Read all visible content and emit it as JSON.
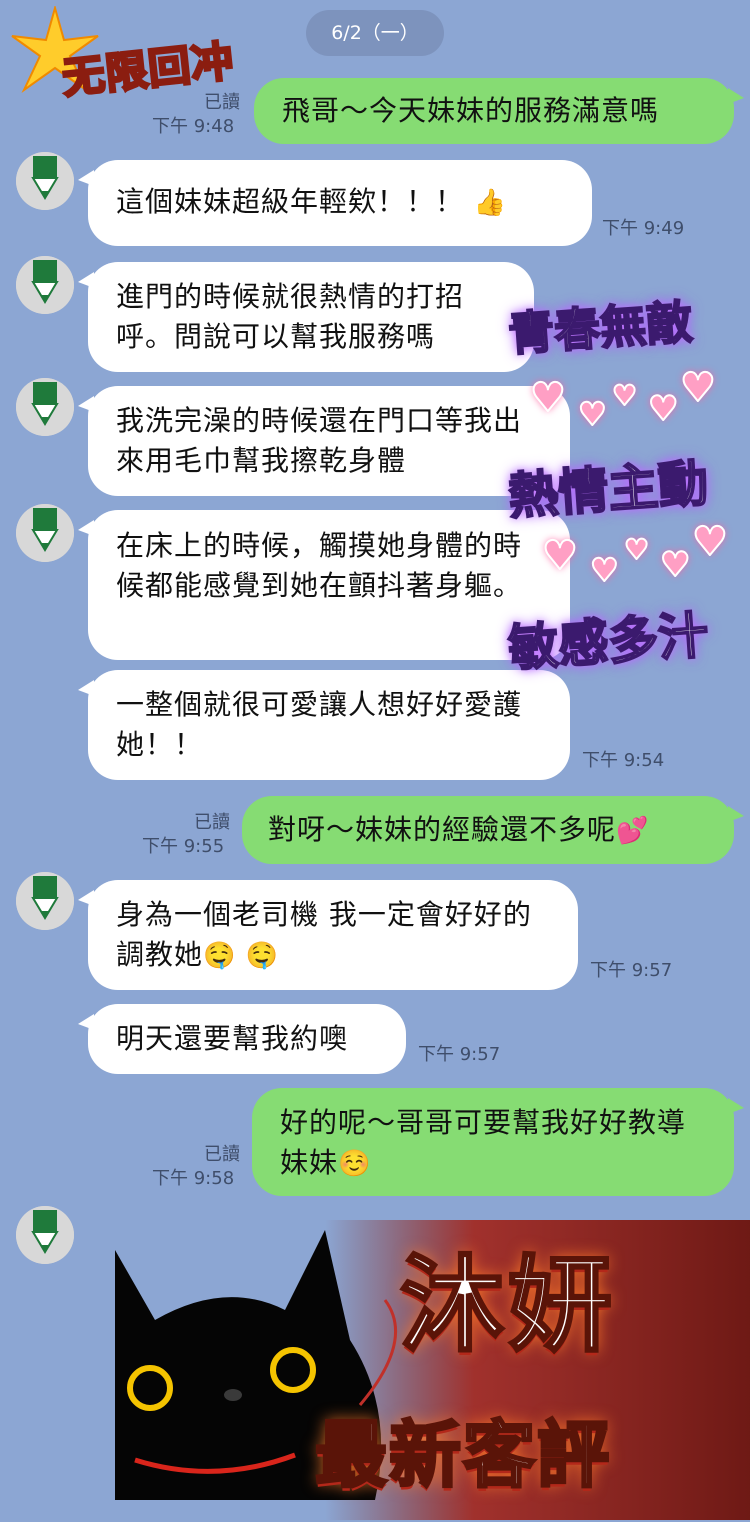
{
  "date_label": "6/2（一）",
  "promo": {
    "top_badge": "无限回冲",
    "side_badges": [
      "青春無敵",
      "熱情主動",
      "敏感多汁"
    ],
    "banner_line1": "沐妍",
    "banner_line2": "最新客評"
  },
  "messages": [
    {
      "side": "out",
      "text": "飛哥～今天妹妹的服務滿意嗎",
      "read": "已讀",
      "time": "下午 9:48"
    },
    {
      "side": "in",
      "text": "這個妹妹超級年輕欸！！！",
      "emoji": "👍",
      "time": "下午 9:49"
    },
    {
      "side": "in",
      "text": "進門的時候就很熱情的打招呼。問說可以幫我服務嗎",
      "time": ""
    },
    {
      "side": "in",
      "text": "我洗完澡的時候還在門口等我出來用毛巾幫我擦乾身體",
      "time": ""
    },
    {
      "side": "in",
      "text": "在床上的時候，觸摸她身體的時候都能感覺到她在顫抖著身軀。",
      "time": ""
    },
    {
      "side": "in",
      "text": "一整個就很可愛讓人想好好愛護她！！",
      "time": "下午 9:54"
    },
    {
      "side": "out",
      "text": "對呀～妹妹的經驗還不多呢",
      "emoji": "💕",
      "read": "已讀",
      "time": "下午 9:55"
    },
    {
      "side": "in",
      "text": "身為一個老司機 我一定會好好的調教她",
      "emoji": "🤤 🤤",
      "time": "下午 9:57"
    },
    {
      "side": "in",
      "text": "明天還要幫我約噢",
      "time": "下午 9:57"
    },
    {
      "side": "out",
      "text": "好的呢～哥哥可要幫我好好教導妹妹",
      "emoji": "☺️",
      "read": "已讀",
      "time": "下午 9:58"
    }
  ],
  "icons": {
    "avatar": "pencil-avatar-icon",
    "sticker": "black-cat-sticker"
  },
  "colors": {
    "background": "#8ca6d3",
    "incoming": "#ffffff",
    "outgoing": "#86dc73"
  }
}
